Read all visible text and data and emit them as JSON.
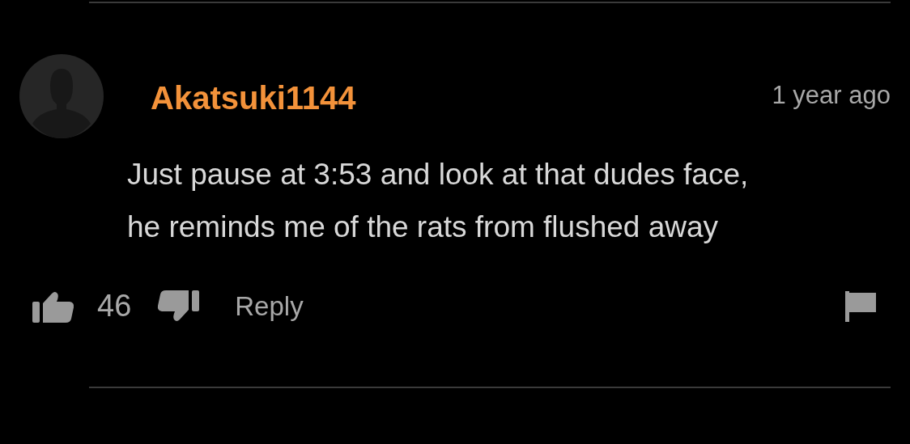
{
  "comment": {
    "username": "Akatsuki1144",
    "time": "1 year ago",
    "text": "Just pause at 3:53 and look at that dudes face,\nhe reminds me of the rats from flushed away",
    "likes": "46",
    "reply": "Reply"
  }
}
